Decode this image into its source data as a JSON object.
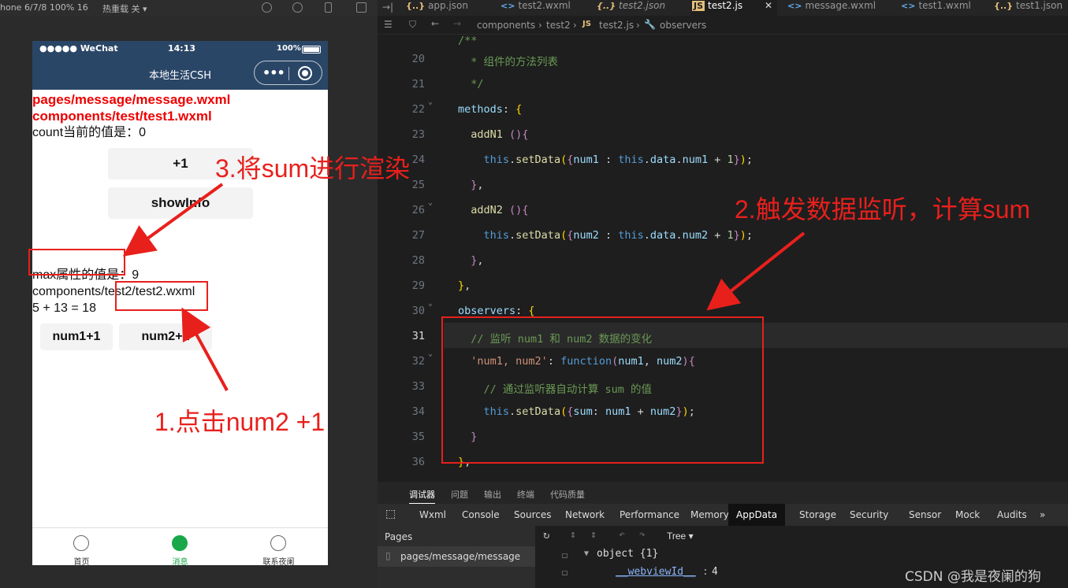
{
  "sim_toolbar": {
    "device": "hone 6/7/8 100% 16",
    "compile_mode": "热重载 关"
  },
  "phone": {
    "status_left": "●●●●● WeChat",
    "status_time": "14:13",
    "status_battery": "100%",
    "nav_title": "本地生活CSH",
    "page": {
      "line1": "pages/message/message.wxml",
      "line2": "components/test/test1.wxml",
      "count_text": "count当前的值是：0",
      "btn_plus1": "+1",
      "btn_showinfo": "showInfo",
      "max_text": "max属性的值是：9",
      "test2_path": "components/test2/test2.wxml",
      "sum_text": "5 + 13 = 18",
      "btn_num1": "num1+1",
      "btn_num2": "num2+1"
    },
    "tabbar": [
      {
        "label": "首页",
        "icon": "home-icon"
      },
      {
        "label": "消息",
        "icon": "message-icon"
      },
      {
        "label": "联系夜阑",
        "icon": "phone-icon"
      }
    ]
  },
  "annotations": {
    "step1": "1.点击num2 +1",
    "step2": "2.触发数据监听，计算sum",
    "step3": "3.将sum进行渲染"
  },
  "editor": {
    "tabs": [
      {
        "icon": "{..}",
        "label": "app.json"
      },
      {
        "icon": "<>",
        "label": "test2.wxml"
      },
      {
        "icon": "{..}",
        "label": "test2.json"
      },
      {
        "icon": "JS",
        "label": "test2.js",
        "active": true
      },
      {
        "icon": "<>",
        "label": "message.wxml"
      },
      {
        "icon": "<>",
        "label": "test1.wxml"
      },
      {
        "icon": "{..}",
        "label": "test1.json"
      }
    ],
    "breadcrumb": {
      "seg1": "components",
      "seg2": "test2",
      "seg3": "test2.js",
      "seg4": "observers"
    },
    "line_numbers": [
      "20",
      "21",
      "22",
      "23",
      "24",
      "25",
      "26",
      "27",
      "28",
      "29",
      "30",
      "31",
      "32",
      "33",
      "34",
      "35",
      "36"
    ],
    "current_line": "31"
  },
  "debug": {
    "top_tabs": [
      "调试器",
      "问题",
      "输出",
      "终端",
      "代码质量"
    ],
    "panel_tabs": [
      "Wxml",
      "Console",
      "Sources",
      "Network",
      "Performance",
      "Memory",
      "AppData",
      "Storage",
      "Security",
      "Sensor",
      "Mock",
      "Audits"
    ],
    "active_panel_tab": "AppData",
    "left_header": "Pages",
    "left_item": "pages/message/message",
    "view_mode": "Tree",
    "tree_root": "object {1}",
    "tree_key": "__webviewId__",
    "tree_value": "4"
  },
  "watermark": "CSDN @我是夜阑的狗"
}
